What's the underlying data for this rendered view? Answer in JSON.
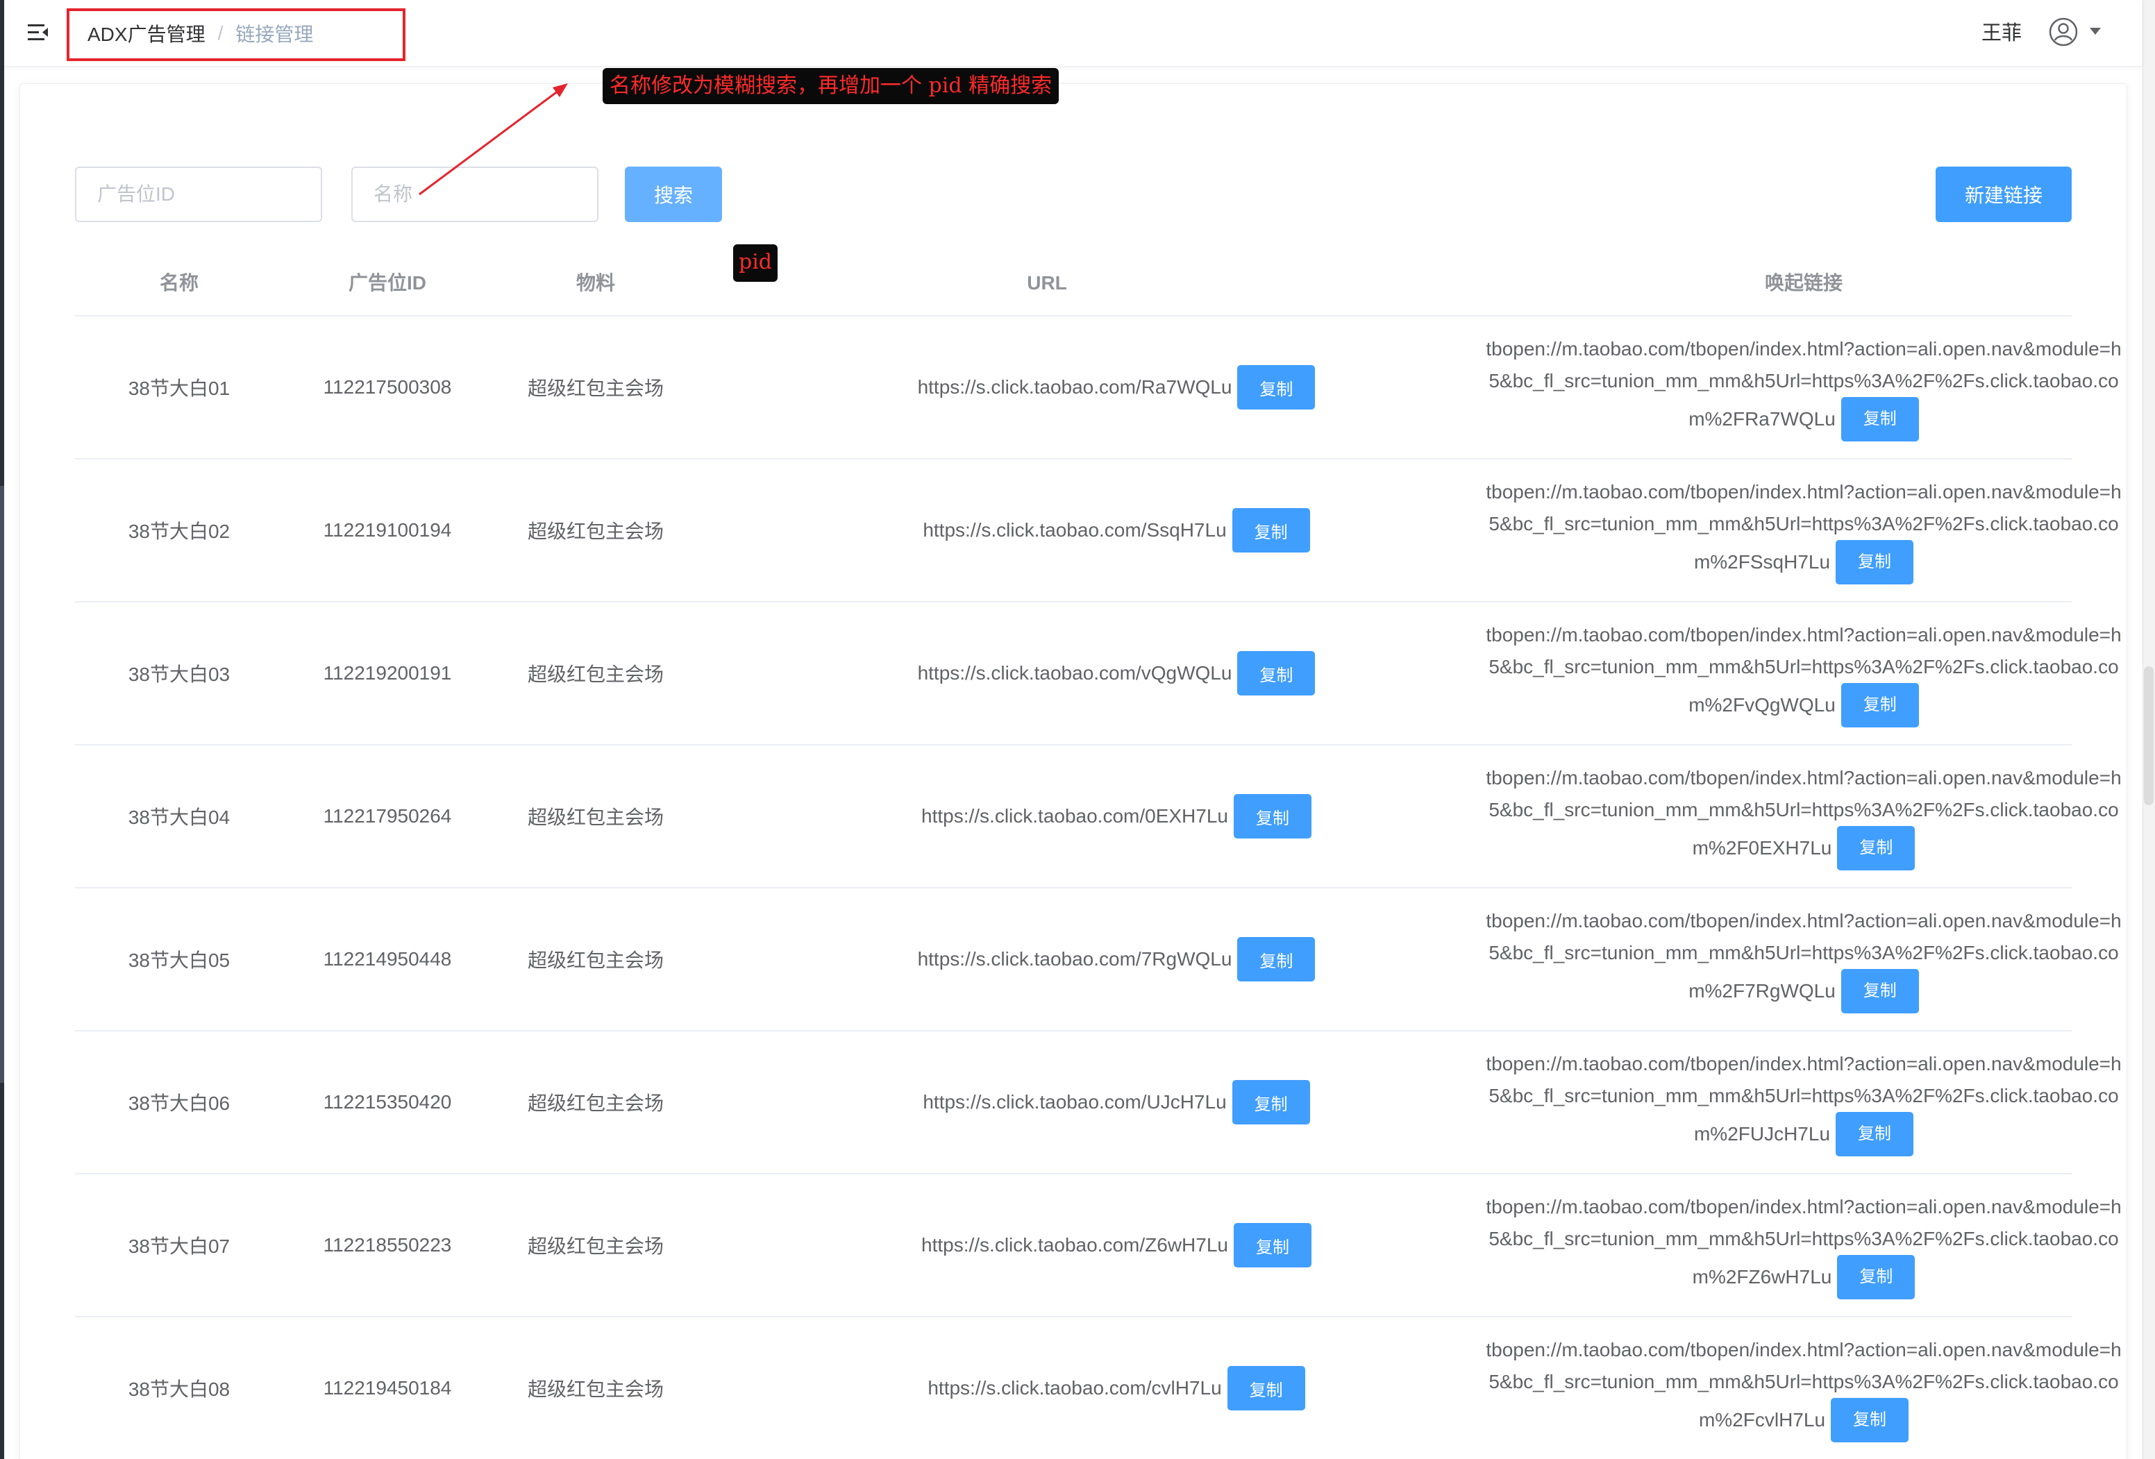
{
  "header": {
    "breadcrumb": [
      "ADX广告管理",
      "链接管理"
    ],
    "user_name": "王菲"
  },
  "annotations": {
    "note": "名称修改为模糊搜索，再增加一个 pid 精确搜索",
    "pid_note": "pid",
    "color": "#e5242e"
  },
  "search": {
    "adslot_placeholder": "广告位ID",
    "name_placeholder": "名称",
    "search_button": "搜索",
    "new_button": "新建链接"
  },
  "table": {
    "columns": [
      "名称",
      "广告位ID",
      "物料",
      "URL",
      "唤起链接"
    ],
    "copy_label": "复制",
    "rows": [
      {
        "name": "38节大白01",
        "adslot_id": "112217500308",
        "material": "超级红包主会场",
        "url": "https://s.click.taobao.com/Ra7WQLu",
        "link_1": "tbopen://m.taobao.com/tbopen/index.html?action=ali.open.nav&module=h",
        "link_2": "5&bc_fl_src=tunion_mm_mm&h5Url=https%3A%2F%2Fs.click.taobao.co",
        "link_3": "m%2FRa7WQLu"
      },
      {
        "name": "38节大白02",
        "adslot_id": "112219100194",
        "material": "超级红包主会场",
        "url": "https://s.click.taobao.com/SsqH7Lu",
        "link_1": "tbopen://m.taobao.com/tbopen/index.html?action=ali.open.nav&module=h",
        "link_2": "5&bc_fl_src=tunion_mm_mm&h5Url=https%3A%2F%2Fs.click.taobao.co",
        "link_3": "m%2FSsqH7Lu"
      },
      {
        "name": "38节大白03",
        "adslot_id": "112219200191",
        "material": "超级红包主会场",
        "url": "https://s.click.taobao.com/vQgWQLu",
        "link_1": "tbopen://m.taobao.com/tbopen/index.html?action=ali.open.nav&module=h",
        "link_2": "5&bc_fl_src=tunion_mm_mm&h5Url=https%3A%2F%2Fs.click.taobao.co",
        "link_3": "m%2FvQgWQLu"
      },
      {
        "name": "38节大白04",
        "adslot_id": "112217950264",
        "material": "超级红包主会场",
        "url": "https://s.click.taobao.com/0EXH7Lu",
        "link_1": "tbopen://m.taobao.com/tbopen/index.html?action=ali.open.nav&module=h",
        "link_2": "5&bc_fl_src=tunion_mm_mm&h5Url=https%3A%2F%2Fs.click.taobao.co",
        "link_3": "m%2F0EXH7Lu"
      },
      {
        "name": "38节大白05",
        "adslot_id": "112214950448",
        "material": "超级红包主会场",
        "url": "https://s.click.taobao.com/7RgWQLu",
        "link_1": "tbopen://m.taobao.com/tbopen/index.html?action=ali.open.nav&module=h",
        "link_2": "5&bc_fl_src=tunion_mm_mm&h5Url=https%3A%2F%2Fs.click.taobao.co",
        "link_3": "m%2F7RgWQLu"
      },
      {
        "name": "38节大白06",
        "adslot_id": "112215350420",
        "material": "超级红包主会场",
        "url": "https://s.click.taobao.com/UJcH7Lu",
        "link_1": "tbopen://m.taobao.com/tbopen/index.html?action=ali.open.nav&module=h",
        "link_2": "5&bc_fl_src=tunion_mm_mm&h5Url=https%3A%2F%2Fs.click.taobao.co",
        "link_3": "m%2FUJcH7Lu"
      },
      {
        "name": "38节大白07",
        "adslot_id": "112218550223",
        "material": "超级红包主会场",
        "url": "https://s.click.taobao.com/Z6wH7Lu",
        "link_1": "tbopen://m.taobao.com/tbopen/index.html?action=ali.open.nav&module=h",
        "link_2": "5&bc_fl_src=tunion_mm_mm&h5Url=https%3A%2F%2Fs.click.taobao.co",
        "link_3": "m%2FZ6wH7Lu"
      },
      {
        "name": "38节大白08",
        "adslot_id": "112219450184",
        "material": "超级红包主会场",
        "url": "https://s.click.taobao.com/cvlH7Lu",
        "link_1": "tbopen://m.taobao.com/tbopen/index.html?action=ali.open.nav&module=h",
        "link_2": "5&bc_fl_src=tunion_mm_mm&h5Url=https%3A%2F%2Fs.click.taobao.co",
        "link_3": "m%2FcvlH7Lu"
      }
    ]
  }
}
